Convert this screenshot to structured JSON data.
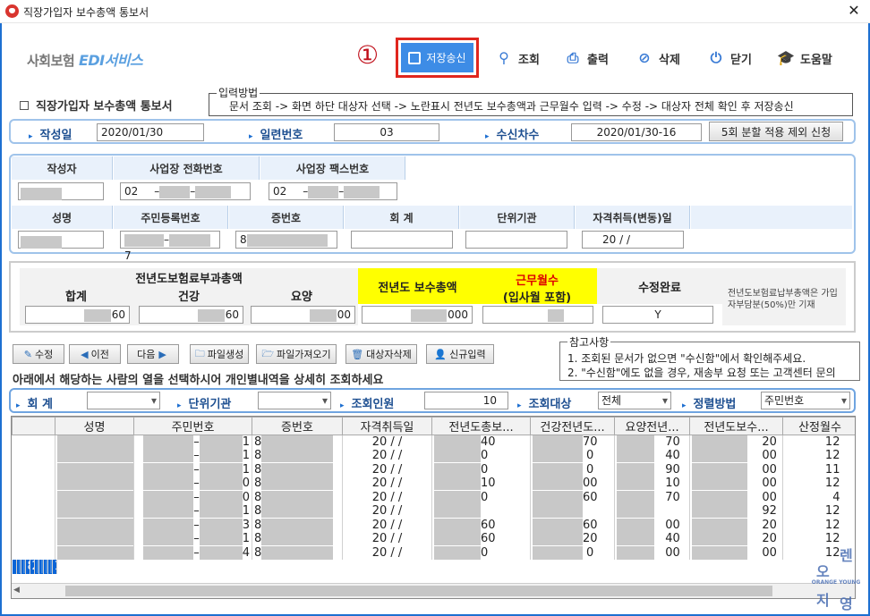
{
  "window": {
    "title": "직장가입자 보수총액 통보서",
    "close": "✕"
  },
  "logo": {
    "main": "사회보험 ",
    "edi": "EDI서비스"
  },
  "annotation": "①",
  "toolbar": {
    "save": "저장송신",
    "query": "조회",
    "print": "출력",
    "delete": "삭제",
    "close": "닫기",
    "help": "도움말"
  },
  "section": {
    "title": "직장가입자 보수총액 통보서"
  },
  "hint": {
    "label": "입력방법",
    "text": "문서 조회 -> 화면 하단 대상자 선택 -> 노란표시 전년도 보수총액과 근무월수 입력 -> 수정 -> 대상자 전체 확인 후 저장송신"
  },
  "meta": {
    "written_label": "작성일",
    "written": "2020/01/30",
    "serial_label": "일련번호",
    "serial": "03",
    "recv_label": "수신차수",
    "recv": "2020/01/30-16",
    "split_btn": "5회 분할 적용 제외 신청"
  },
  "company": {
    "writer_label": "작성자",
    "phone_label": "사업장 전화번호",
    "phone_prefix": "02",
    "dash": "–",
    "fax_label": "사업장 팩스번호",
    "fax_prefix": "02"
  },
  "person": {
    "name_label": "성명",
    "rrn_label": "주민등록번호",
    "rrn_end": "7",
    "card_label": "증번호",
    "card_start": "8",
    "account_label": "회 계",
    "unit_label": "단위기관",
    "qual_label": "자격취득(변동)일",
    "qual_value": "20  /  /"
  },
  "summary": {
    "group_label": "전년도보험료부과총액",
    "total_label": "합계",
    "total_value": "60",
    "health_label": "건강",
    "health_value": "60",
    "care_label": "요양",
    "care_value": "00",
    "prev_pay_label": "전년도 보수총액",
    "prev_pay_value": "000",
    "months_label": "근무월수",
    "months_sub": "(입사월 포함)",
    "done_label": "수정완료",
    "done_value": "Y",
    "note": "전년도보험료납부총액은 가입자부담분(50%)만 기재"
  },
  "actions": {
    "edit": "수정",
    "prev": "이전",
    "next": "다음",
    "file_create": "파일생성",
    "file_import": "파일가져오기",
    "target_delete": "대상자삭제",
    "new_input": "신규입력"
  },
  "notes": {
    "label": "참고사항",
    "line1": "1. 조회된 문서가 없으면 \"수신함\"에서 확인해주세요.",
    "line2": "2. \"수신함\"에도 없을 경우, 재송부 요청 또는 고객센터 문의"
  },
  "instruction": "아래에서 해당하는 사람의 열을 선택하시어 개인별내역을 상세히 조회하세요",
  "filter": {
    "account_label": "회  계",
    "unit_label": "단위기관",
    "count_label": "조회인원",
    "count_value": "10",
    "target_label": "조회대상",
    "target_value": "전체",
    "sort_label": "정렬방법",
    "sort_value": "주민번호"
  },
  "grid": {
    "columns": [
      "성명",
      "주민번호",
      "증번호",
      "자격취득일",
      "전년도총보...",
      "건강전년도...",
      "요양전년...",
      "전년도보수...",
      "산정월수"
    ],
    "rows": [
      {
        "rrn": "1",
        "card": "8",
        "qual": "20  /  /",
        "total": "40",
        "health": "70",
        "care": "70",
        "pay": "20",
        "months": "12"
      },
      {
        "rrn": "1",
        "card": "8",
        "qual": "20  /  /",
        "total": "0",
        "health": "0",
        "care": "40",
        "pay": "00",
        "months": "12"
      },
      {
        "rrn": "1",
        "card": "8",
        "qual": "20  /  /",
        "total": "0",
        "health": "0",
        "care": "90",
        "pay": "00",
        "months": "11"
      },
      {
        "rrn": "0",
        "card": "8",
        "qual": "20  /  /",
        "total": "10",
        "health": "00",
        "care": "10",
        "pay": "00",
        "months": "12"
      },
      {
        "rrn": "0",
        "card": "8",
        "qual": "20  /  /",
        "total": "0",
        "health": "60",
        "care": "70",
        "pay": "00",
        "months": "4"
      },
      {
        "rrn": "1",
        "card": "8",
        "qual": "20  /  /",
        "total": "",
        "health": "",
        "care": "",
        "pay": "92",
        "months": "12"
      },
      {
        "rrn": "3",
        "card": "8",
        "qual": "20  /  /",
        "total": "60",
        "health": "60",
        "care": "00",
        "pay": "20",
        "months": "12"
      },
      {
        "rrn": "1",
        "card": "8",
        "qual": "20  /  /",
        "total": "60",
        "health": "20",
        "care": "40",
        "pay": "20",
        "months": "12"
      },
      {
        "rrn": "4",
        "card": "8",
        "qual": "20  /  /",
        "total": "0",
        "health": "0",
        "care": "00",
        "pay": "00",
        "months": "12"
      },
      {
        "rrn": "7",
        "card": "8",
        "qual": "20  /  /",
        "total": "0",
        "health": "0",
        "care": "00",
        "pay": "00",
        "months": "12"
      }
    ]
  },
  "watermark": {
    "top": "오",
    "right": "렌",
    "mid": "ORANGE YOUNG",
    "bl": "지",
    "br": "영"
  },
  "colors": {
    "accent": "#1d6fd1",
    "save_btn": "#3d8ce6",
    "highlight": "#ffff00",
    "selected_row": "#0a64d6",
    "annotation": "#e0261e"
  }
}
